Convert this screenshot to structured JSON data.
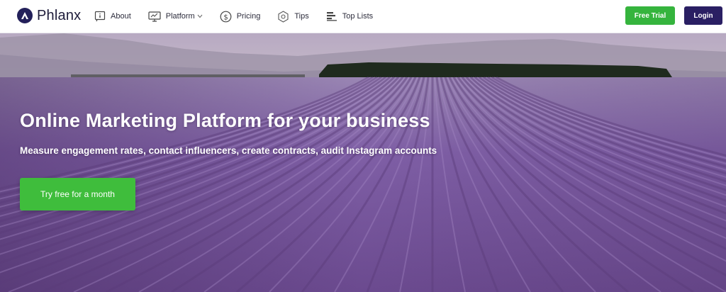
{
  "brand": {
    "name": "Phlanx",
    "logo_icon": "triangle-logo-icon"
  },
  "nav": {
    "items": [
      {
        "label": "About",
        "icon": "info-board-icon"
      },
      {
        "label": "Platform",
        "icon": "monitor-icon",
        "has_dropdown": true
      },
      {
        "label": "Pricing",
        "icon": "dollar-circle-icon"
      },
      {
        "label": "Tips",
        "icon": "gear-gem-icon"
      },
      {
        "label": "Top Lists",
        "icon": "bar-list-icon"
      }
    ],
    "free_trial_label": "Free Trial",
    "login_label": "Login"
  },
  "hero": {
    "headline": "Online Marketing Platform for your business",
    "subheadline": "Measure engagement rates, contact influencers, create contracts, audit Instagram accounts",
    "cta_label": "Try free for a month"
  },
  "colors": {
    "brand_dark": "#2a1f63",
    "accent_green": "#35b43d",
    "lavender": "#8a6bb0"
  }
}
